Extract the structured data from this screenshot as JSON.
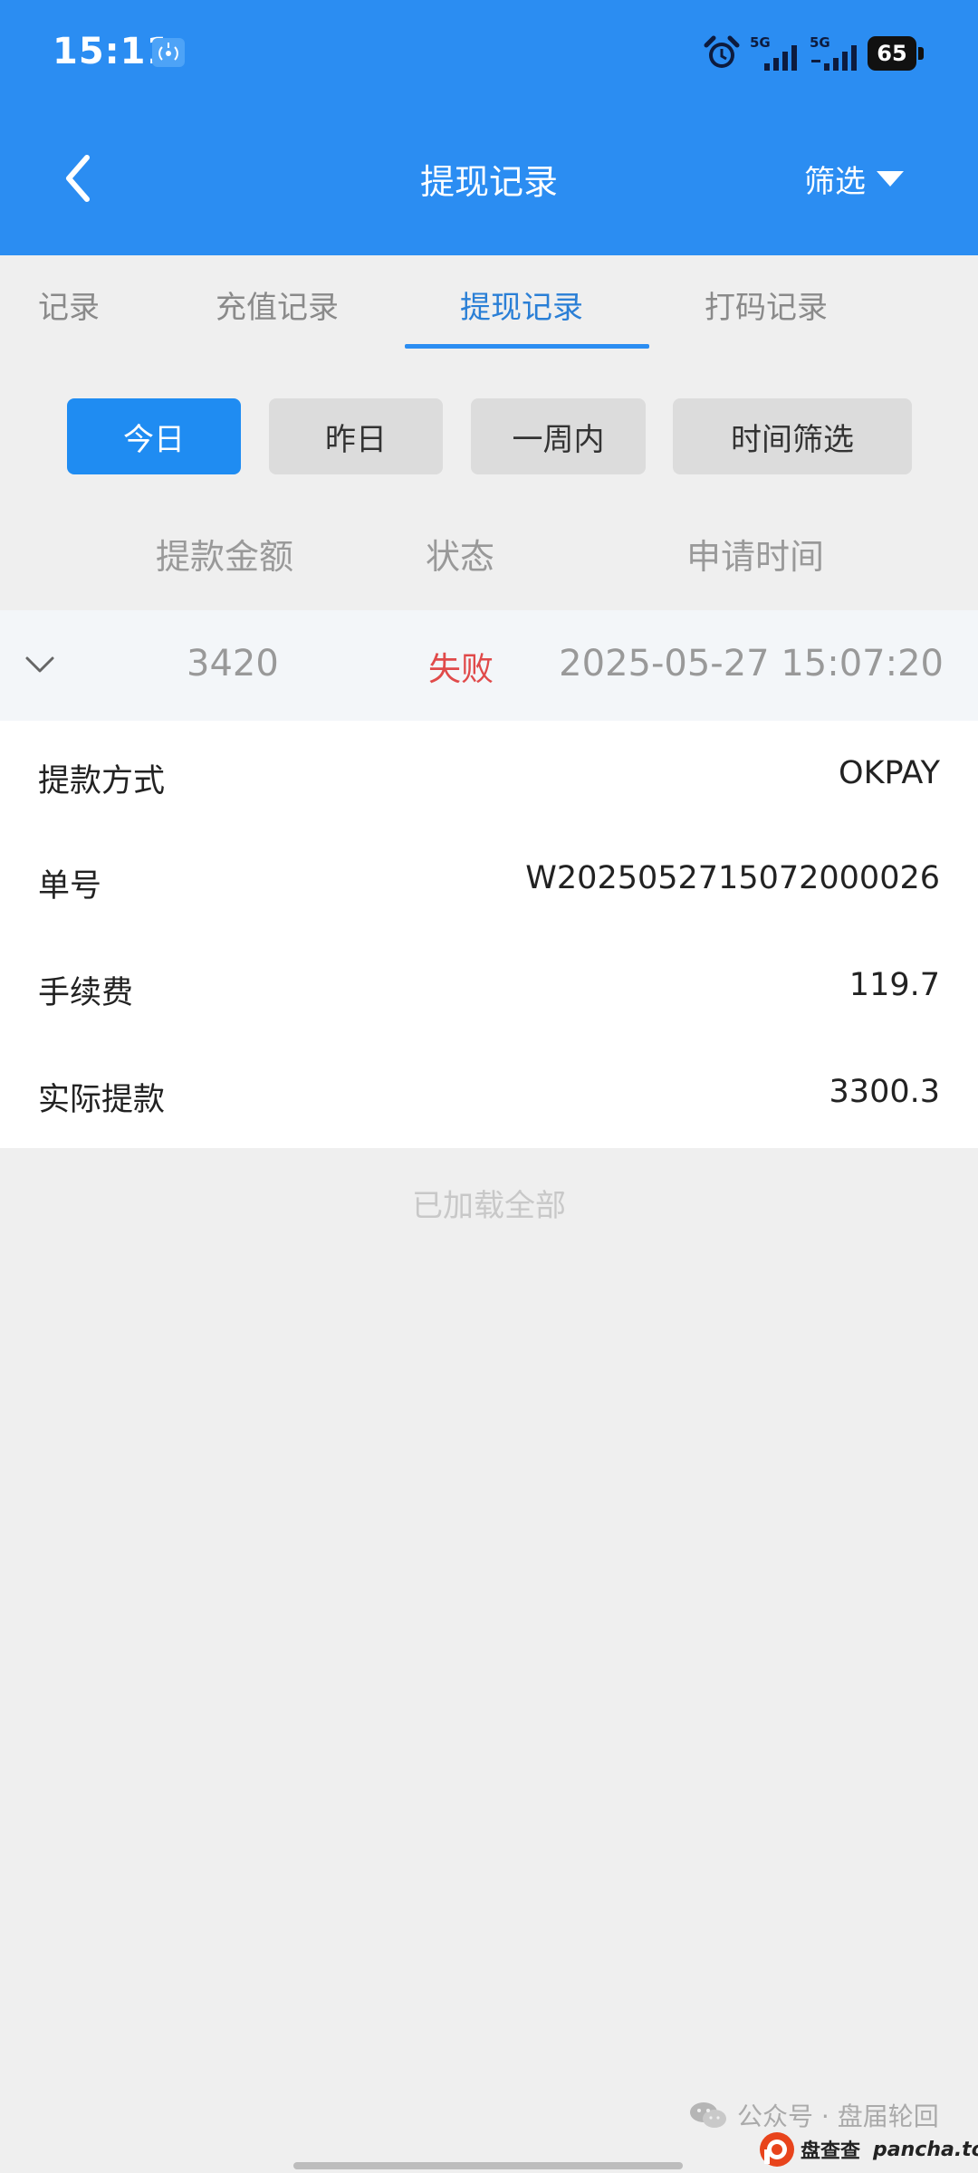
{
  "status_bar": {
    "time": "15:11",
    "signal1_label": "5G",
    "signal2_label": "5G",
    "battery": "65"
  },
  "nav": {
    "title": "提现记录",
    "filter_label": "筛选"
  },
  "tabs": [
    {
      "label": "记录"
    },
    {
      "label": "充值记录"
    },
    {
      "label": "提现记录"
    },
    {
      "label": "打码记录"
    }
  ],
  "active_tab": 2,
  "time_filters": [
    {
      "label": "今日"
    },
    {
      "label": "昨日"
    },
    {
      "label": "一周内"
    },
    {
      "label": "时间筛选"
    }
  ],
  "active_time_filter": 0,
  "columns": {
    "amount": "提款金额",
    "status": "状态",
    "time": "申请时间"
  },
  "record": {
    "amount": "3420",
    "status": "失败",
    "apply_time": "2025-05-27 15:07:20",
    "details": [
      {
        "label": "提款方式",
        "value": "OKPAY"
      },
      {
        "label": "单号",
        "value": "W2025052715072000026"
      },
      {
        "label": "手续费",
        "value": "119.7"
      },
      {
        "label": "实际提款",
        "value": "3300.3"
      }
    ]
  },
  "list_footer": "已加载全部",
  "watermark": {
    "account": "公众号 · 盘届轮回",
    "logo_cn": "盘查查",
    "logo_url": "pancha.top"
  },
  "colors": {
    "header_bg": "#2b8df2",
    "active_button": "#1f8cf2",
    "status_failed": "#e04a4a",
    "active_tab_text": "#2a7fd6"
  }
}
